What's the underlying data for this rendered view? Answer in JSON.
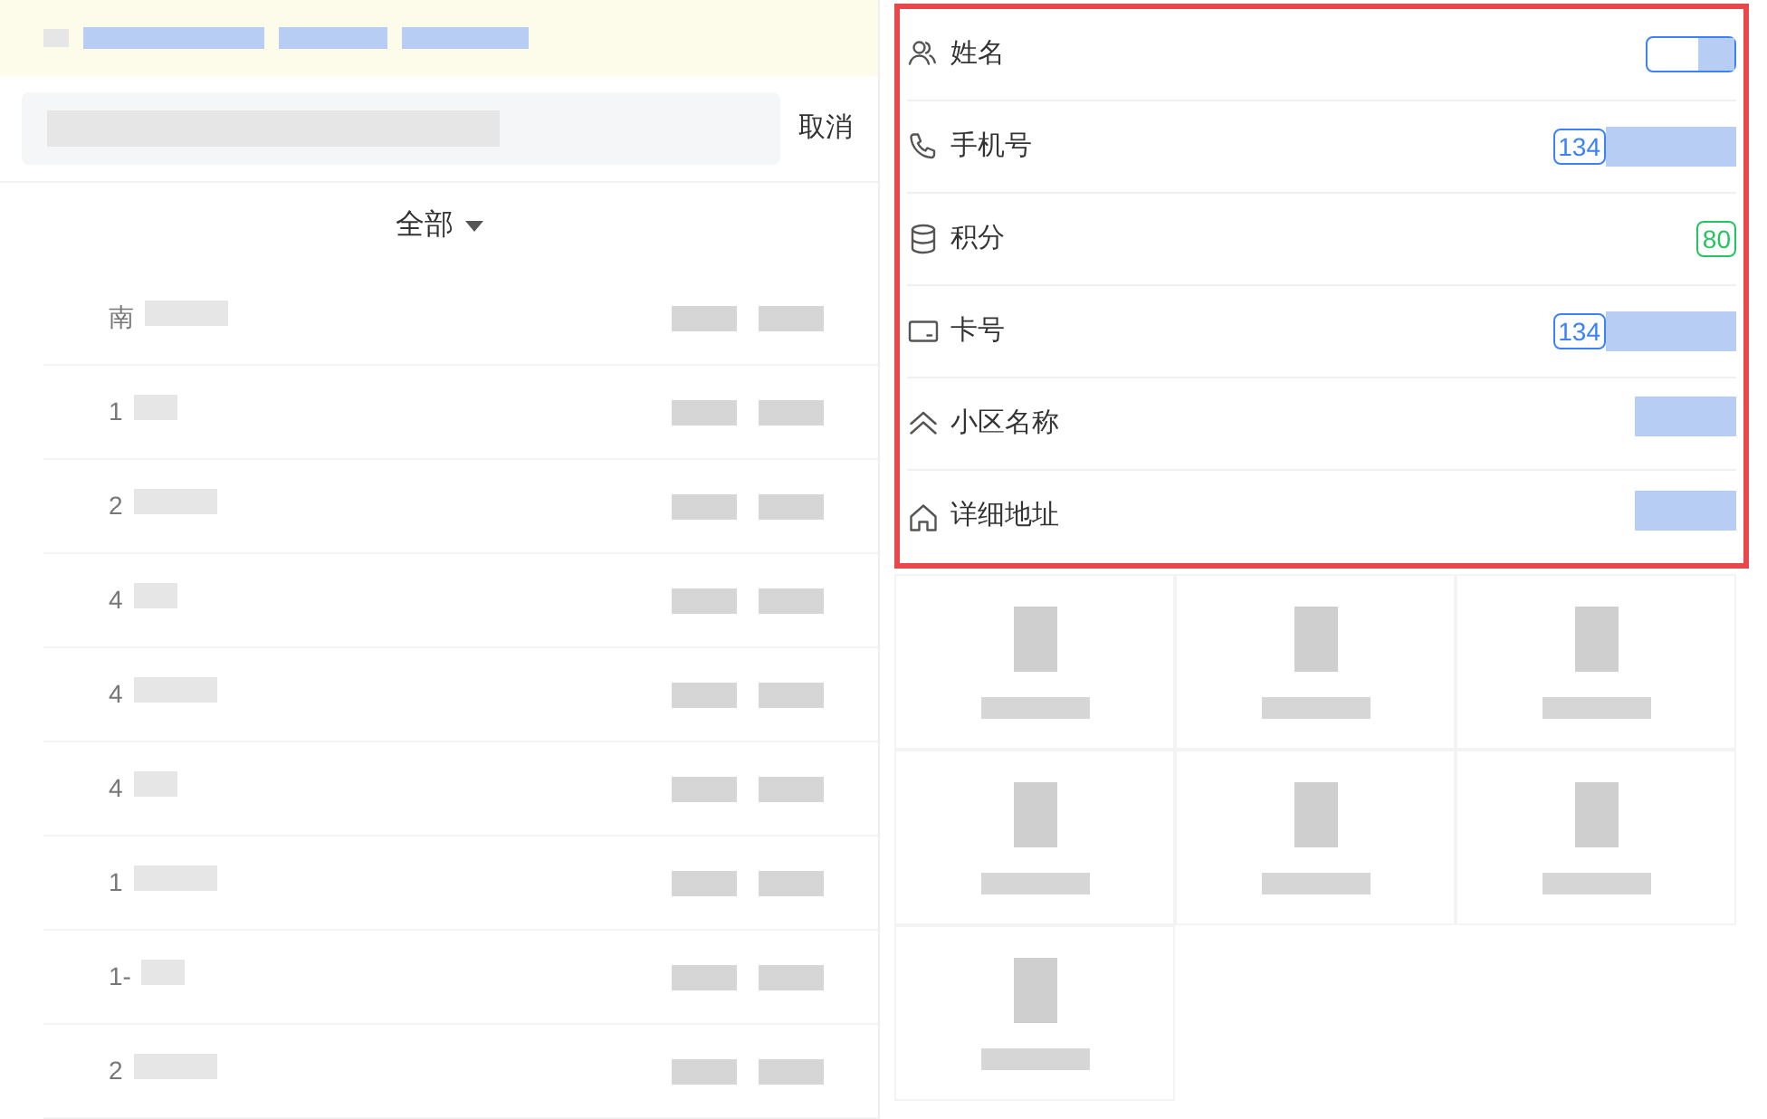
{
  "search": {
    "cancel": "取消"
  },
  "filter": {
    "label": "全部"
  },
  "list": [
    {
      "lead": "南"
    },
    {
      "lead": "1"
    },
    {
      "lead": "2"
    },
    {
      "lead": "4"
    },
    {
      "lead": "4"
    },
    {
      "lead": "4"
    },
    {
      "lead": "1"
    },
    {
      "lead": "1-"
    },
    {
      "lead": "2"
    }
  ],
  "profile": [
    {
      "label": "姓名",
      "kind": "blur-tag",
      "color": "#3b82f6"
    },
    {
      "label": "手机号",
      "kind": "tag",
      "value": "134",
      "color": "#3b82f6"
    },
    {
      "label": "积分",
      "kind": "tag",
      "value": "80",
      "color": "#22c55e"
    },
    {
      "label": "卡号",
      "kind": "tag",
      "value": "134",
      "color": "#3b82f6"
    },
    {
      "label": "小区名称",
      "kind": "blur"
    },
    {
      "label": "详细地址",
      "kind": "blur"
    }
  ],
  "tiles": [
    {
      "kind": "blurred"
    },
    {
      "kind": "blurred"
    },
    {
      "kind": "blurred"
    },
    {
      "kind": "blurred"
    },
    {
      "kind": "blurred"
    },
    {
      "kind": "blurred"
    },
    {
      "kind": "blurred"
    }
  ]
}
